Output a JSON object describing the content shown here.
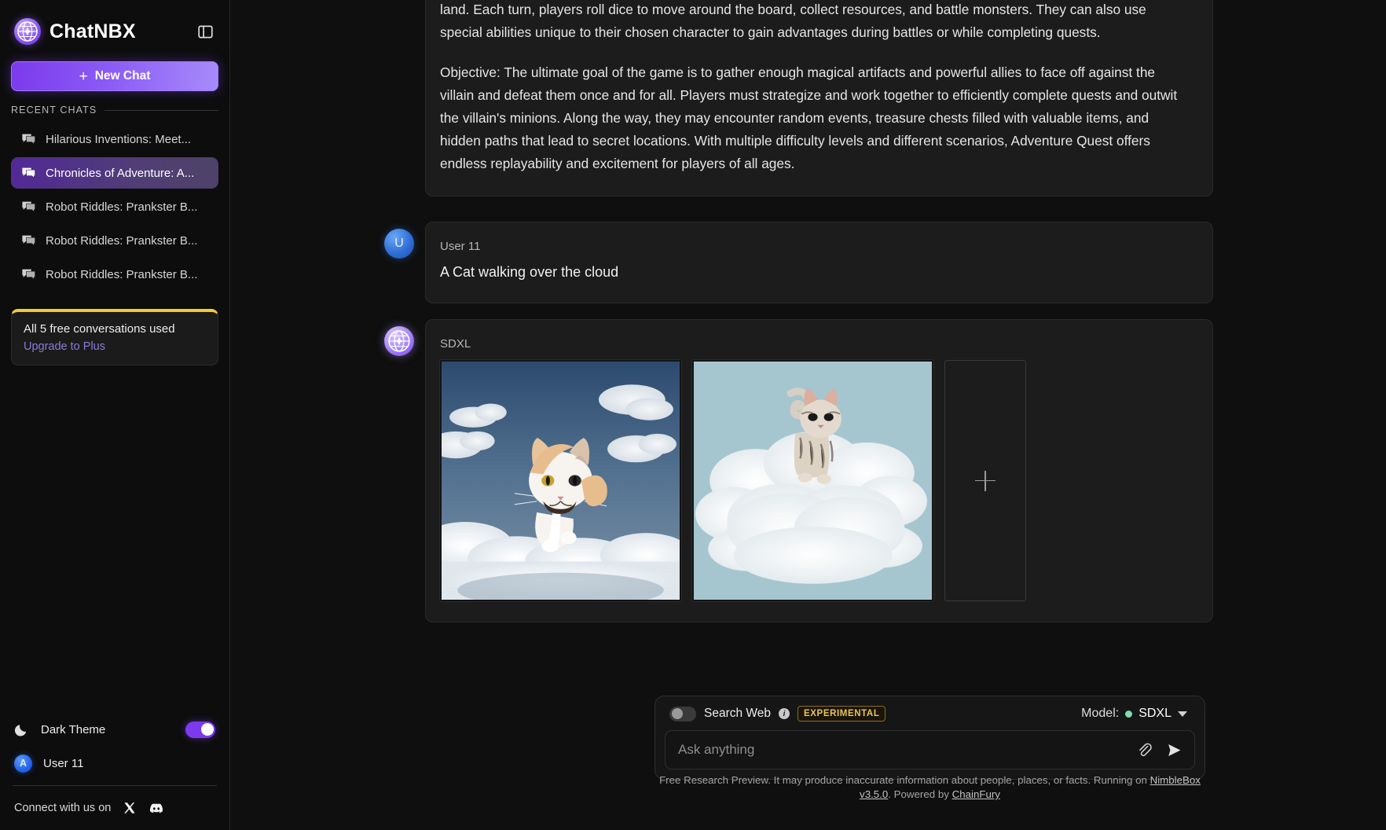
{
  "sidebar": {
    "brand": "ChatNBX",
    "panel_toggle_icon": "sidebar-panel-icon",
    "new_chat_label": "New Chat",
    "new_chat_plus": "+",
    "recent_header": "RECENT CHATS",
    "chats": [
      {
        "label": "Hilarious Inventions: Meet...",
        "active": false
      },
      {
        "label": "Chronicles of Adventure: A...",
        "active": true
      },
      {
        "label": "Robot Riddles: Prankster B...",
        "active": false
      },
      {
        "label": "Robot Riddles: Prankster B...",
        "active": false
      },
      {
        "label": "Robot Riddles: Prankster B...",
        "active": false
      }
    ],
    "upgrade": {
      "title": "All 5 free conversations used",
      "link": "Upgrade to Plus",
      "accent_color": "#f2c83c"
    },
    "theme": {
      "label": "Dark Theme",
      "icon": "moon-icon",
      "enabled": true
    },
    "user": {
      "initial": "A",
      "name": "User 11"
    },
    "connect": {
      "label": "Connect with us on",
      "socials": [
        "x-icon",
        "discord-icon"
      ]
    }
  },
  "thread": {
    "assistant_prev": {
      "paragraphs": [
        "land. Each turn, players roll dice to move around the board, collect resources, and battle monsters. They can also use special abilities unique to their chosen character to gain advantages during battles or while completing quests.",
        "Objective: The ultimate goal of the game is to gather enough magical artifacts and powerful allies to face off against the villain and defeat them once and for all. Players must strategize and work together to efficiently complete quests and outwit the villain's minions. Along the way, they may encounter random events, treasure chests filled with valuable items, and hidden paths that lead to secret locations. With multiple difficulty levels and different scenarios, Adventure Quest offers endless replayability and excitement for players of all ages."
      ]
    },
    "user_message": {
      "avatar_initial": "U",
      "sender": "User 11",
      "text": "A Cat walking over the cloud"
    },
    "assistant_message": {
      "sender": "SDXL",
      "images": [
        {
          "alt": "ginger and white cat walking over clouds in deep blue sky"
        },
        {
          "alt": "tabby cat standing on a large white cloud in pale blue sky"
        }
      ],
      "add_placeholder": "+"
    }
  },
  "composer": {
    "search_web_label": "Search Web",
    "search_web_enabled": false,
    "info_icon": "info-icon",
    "experimental_badge": "EXPERIMENTAL",
    "model_label": "Model:",
    "model_value": "SDXL",
    "model_status_color": "#7ddcad",
    "placeholder": "Ask anything",
    "input_value": "",
    "attach_icon": "paperclip-icon",
    "send_icon": "send-icon"
  },
  "footer": {
    "text_1": "Free Research Preview. It may produce inaccurate information about people, places, or facts. Running on ",
    "link_1": "NimbleBox v3.5.0",
    "text_2": ". Powered by ",
    "link_2": "ChainFury"
  }
}
